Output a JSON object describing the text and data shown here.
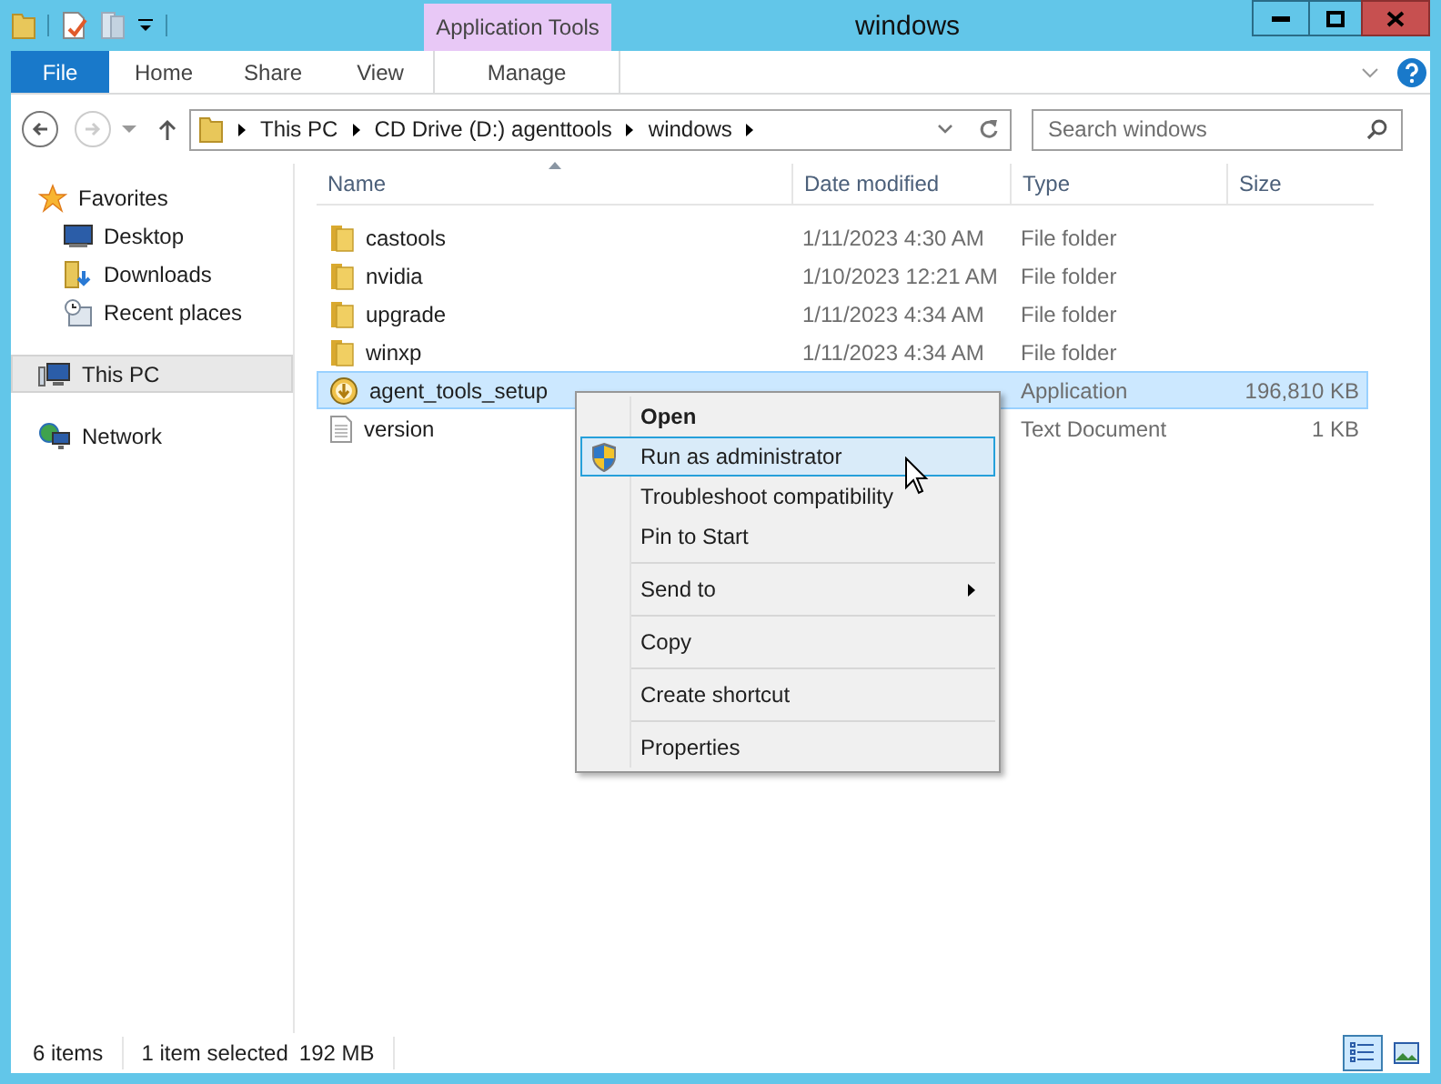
{
  "window": {
    "title": "windows"
  },
  "contextual_tab": {
    "label": "Application Tools"
  },
  "ribbon_tabs": [
    {
      "label": "File",
      "kind": "file"
    },
    {
      "label": "Home",
      "kind": "normal"
    },
    {
      "label": "Share",
      "kind": "normal"
    },
    {
      "label": "View",
      "kind": "normal"
    },
    {
      "label": "Manage",
      "kind": "contextual"
    }
  ],
  "address_bar": {
    "breadcrumbs": [
      "This PC",
      "CD Drive (D:) agenttools",
      "windows"
    ]
  },
  "search": {
    "placeholder": "Search windows"
  },
  "navigation": [
    {
      "label": "Favorites",
      "kind": "star",
      "selected": false,
      "children": [
        {
          "label": "Desktop",
          "kind": "desktop",
          "selected": false
        },
        {
          "label": "Downloads",
          "kind": "downloads",
          "selected": false
        },
        {
          "label": "Recent places",
          "kind": "recent",
          "selected": false
        }
      ]
    },
    {
      "label": "This PC",
      "kind": "pc",
      "selected": true
    },
    {
      "label": "Network",
      "kind": "network",
      "selected": false
    }
  ],
  "columns": [
    {
      "label": "Name",
      "sorted": true
    },
    {
      "label": "Date modified",
      "sorted": false
    },
    {
      "label": "Type",
      "sorted": false
    },
    {
      "label": "Size",
      "sorted": false
    }
  ],
  "rows": [
    {
      "name": "castools",
      "date": "1/11/2023 4:30 AM",
      "type": "File folder",
      "kind": "folder",
      "selected": false
    },
    {
      "name": "nvidia",
      "date": "1/10/2023 12:21 AM",
      "type": "File folder",
      "kind": "folder",
      "selected": false
    },
    {
      "name": "upgrade",
      "date": "1/11/2023 4:34 AM",
      "type": "File folder",
      "kind": "folder",
      "selected": false
    },
    {
      "name": "winxp",
      "date": "1/11/2023 4:34 AM",
      "type": "File folder",
      "kind": "folder",
      "selected": false
    },
    {
      "name": "agent_tools_setup",
      "type": "Application",
      "size": "196,810 KB",
      "kind": "app",
      "selected": true
    },
    {
      "name": "version",
      "type": "Text Document",
      "size": "1 KB",
      "kind": "text",
      "selected": false
    }
  ],
  "context_menu": [
    {
      "label": "Open",
      "kind": "default",
      "selected": false,
      "separator_before": false
    },
    {
      "label": "Run as administrator",
      "kind": "elevated",
      "selected": true,
      "separator_before": false
    },
    {
      "label": "Troubleshoot compatibility",
      "kind": "normal",
      "selected": false,
      "separator_before": false
    },
    {
      "label": "Pin to Start",
      "kind": "normal",
      "selected": false,
      "separator_before": false
    },
    {
      "label": "Send to",
      "kind": "submenu",
      "selected": false,
      "separator_before": true
    },
    {
      "label": "Copy",
      "kind": "normal",
      "selected": false,
      "separator_before": true
    },
    {
      "label": "Create shortcut",
      "kind": "normal",
      "selected": false,
      "separator_before": true
    },
    {
      "label": "Properties",
      "kind": "normal",
      "selected": false,
      "separator_before": true
    }
  ],
  "status_bar": {
    "item_count": "6 items",
    "selection": "1 item selected",
    "selection_size": "192 MB"
  },
  "view_buttons": [
    {
      "kind": "details",
      "selected": true
    },
    {
      "kind": "large",
      "selected": false
    }
  ]
}
